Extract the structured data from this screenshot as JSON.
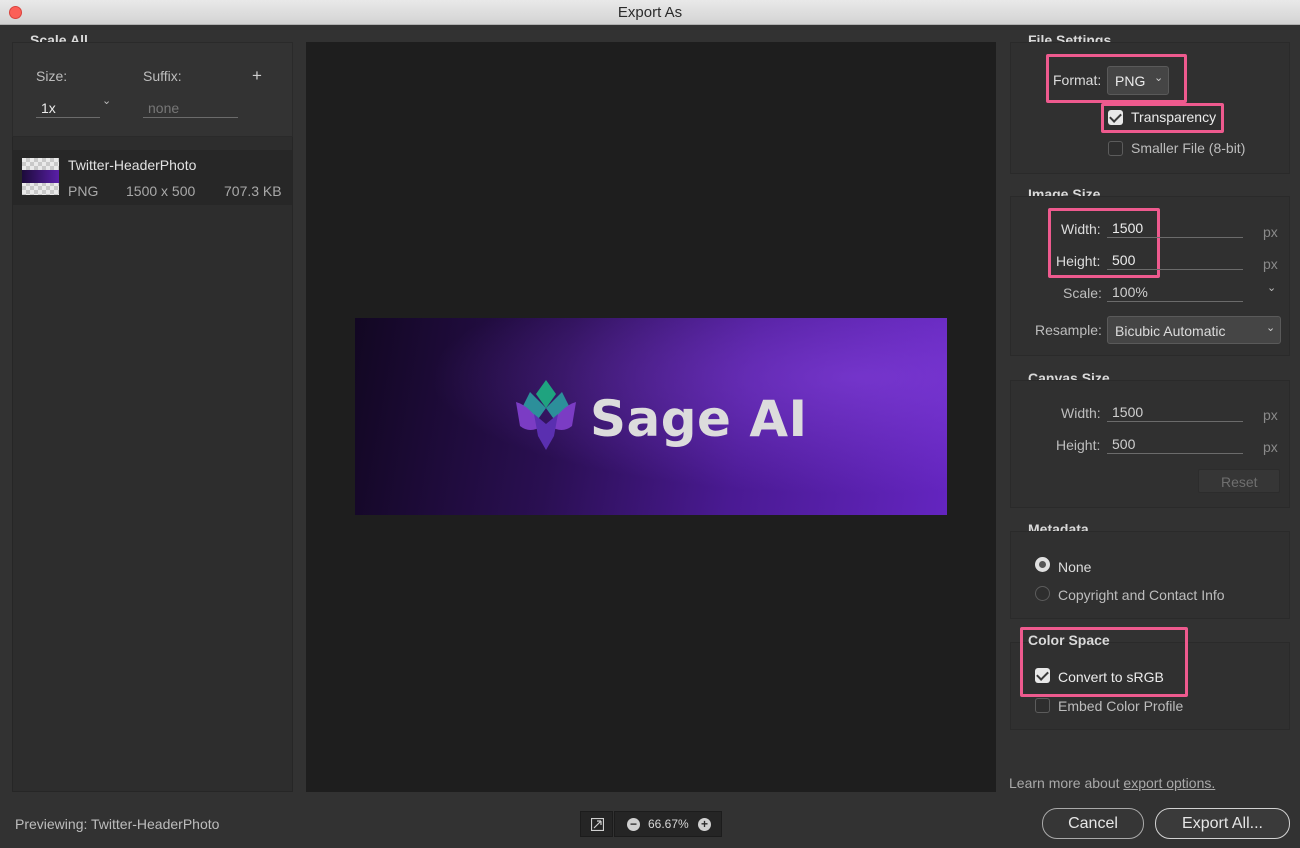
{
  "window": {
    "title": "Export As"
  },
  "scale_all": {
    "title": "Scale All",
    "size_label": "Size:",
    "suffix_label": "Suffix:",
    "add_symbol": "+",
    "size_value": "1x",
    "suffix_placeholder": "none"
  },
  "asset": {
    "name": "Twitter-HeaderPhoto",
    "format": "PNG",
    "dimensions": "1500 x 500",
    "filesize": "707.3 KB"
  },
  "preview": {
    "banner_text": "Sage AI"
  },
  "file_settings": {
    "title": "File Settings",
    "format_label": "Format:",
    "format_value": "PNG",
    "transparency_label": "Transparency",
    "transparency_checked": true,
    "smaller_file_label": "Smaller File (8-bit)",
    "smaller_file_checked": false
  },
  "image_size": {
    "title": "Image Size",
    "width_label": "Width:",
    "width_value": "1500",
    "height_label": "Height:",
    "height_value": "500",
    "unit": "px",
    "scale_label": "Scale:",
    "scale_value": "100%",
    "resample_label": "Resample:",
    "resample_value": "Bicubic Automatic"
  },
  "canvas_size": {
    "title": "Canvas Size",
    "width_label": "Width:",
    "width_value": "1500",
    "height_label": "Height:",
    "height_value": "500",
    "unit": "px",
    "reset_label": "Reset"
  },
  "metadata": {
    "title": "Metadata",
    "options": [
      "None",
      "Copyright and Contact Info"
    ],
    "selected": "None"
  },
  "color_space": {
    "title": "Color Space",
    "convert_label": "Convert to sRGB",
    "convert_checked": true,
    "embed_label": "Embed Color Profile",
    "embed_checked": false
  },
  "footer": {
    "previewing_label": "Previewing:",
    "previewing_name": "Twitter-HeaderPhoto",
    "zoom_value": "66.67%",
    "learn_more_text": "Learn more about",
    "learn_more_link": "export options.",
    "cancel_label": "Cancel",
    "export_all_label": "Export All..."
  },
  "colors": {
    "highlight": "#ee5a8e",
    "background": "#323232",
    "preview_bg": "#1e1e1e"
  }
}
